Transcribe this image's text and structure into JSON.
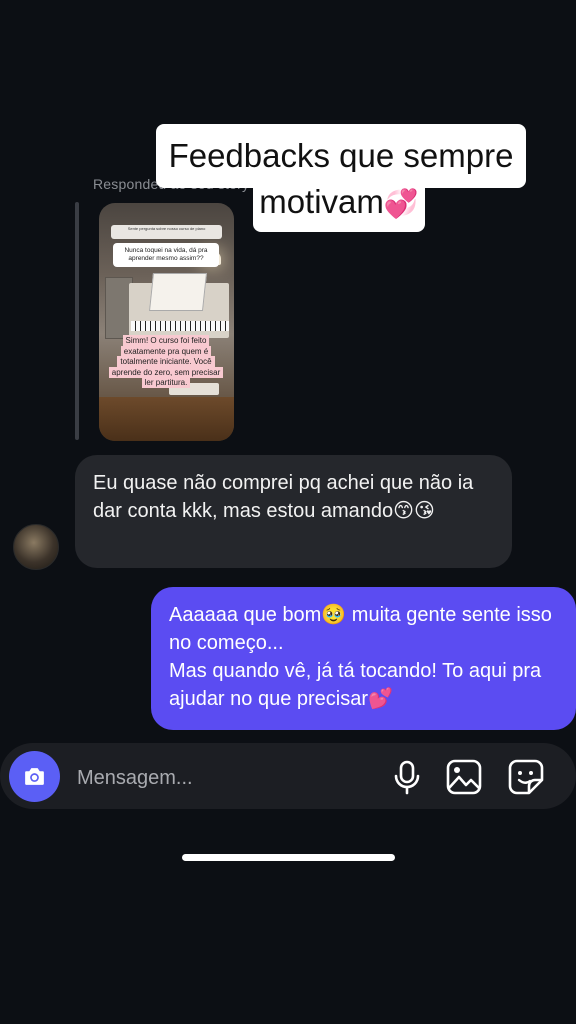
{
  "reply_context": {
    "label": "Respondeu ao seu story"
  },
  "story": {
    "top_text": "Sente pergunta sobre nosso curso de piano",
    "question": "Nunca toquei na vida, dá pra aprender mesmo assim??",
    "answer": "Simm! O curso foi feito exatamente pra quem é totalmente iniciante. Você aprende do zero, sem precisar ler partitura."
  },
  "caption": {
    "line1": "Feedbacks que sempre me",
    "line2": "motivam",
    "line2_emoji": "💞"
  },
  "messages": [
    {
      "direction": "incoming",
      "text": "Eu quase não comprei pq achei que não ia dar conta kkk, mas estou amando😙😘"
    },
    {
      "direction": "outgoing",
      "line1": "Aaaaaa que bom🥹 muita gente sente isso no começo...",
      "line2": "Mas quando vê, já tá tocando! To aqui pra ajudar no que precisar💕"
    }
  ],
  "composer": {
    "placeholder": "Mensagem...",
    "icons": [
      "camera-icon",
      "microphone-icon",
      "gallery-icon",
      "sticker-icon"
    ]
  },
  "colors": {
    "background": "#0c0f14",
    "incoming_bubble": "#25272c",
    "outgoing_bubble": "#5b4cf2",
    "camera_button": "#5b5ff5"
  }
}
